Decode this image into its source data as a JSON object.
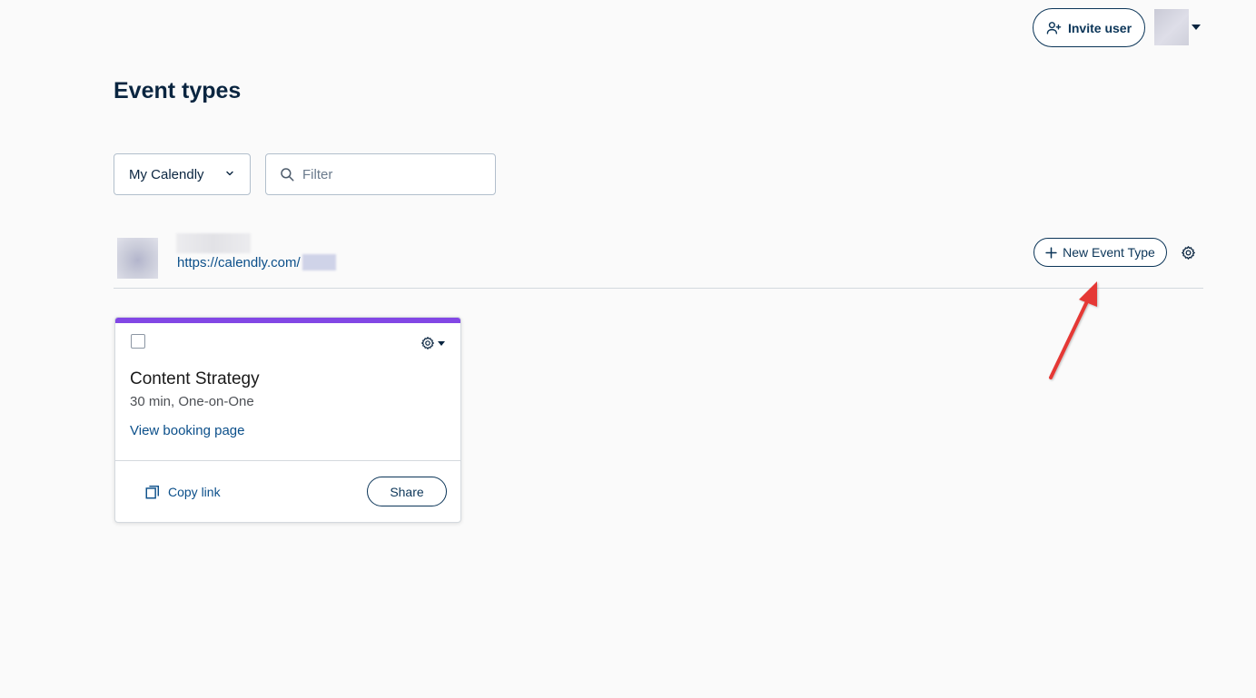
{
  "header": {
    "invite_label": "Invite user"
  },
  "page": {
    "title": "Event types"
  },
  "filters": {
    "calendar_selected": "My Calendly",
    "filter_placeholder": "Filter",
    "filter_value": ""
  },
  "user": {
    "link_text": "https://calendly.com/",
    "new_event_label": "New Event Type"
  },
  "event_cards": [
    {
      "title": "Content Strategy",
      "meta": "30 min, One-on-One",
      "view_link": "View booking page",
      "copy_label": "Copy link",
      "share_label": "Share",
      "accent_color": "#8247e5"
    }
  ],
  "icons": {
    "invite": "add-user-icon",
    "avatar_menu": "caret-down-icon",
    "calendar_select": "chevron-down-icon",
    "filter": "search-icon",
    "new_event": "plus-icon",
    "settings": "gear-icon",
    "copy": "copy-icon"
  },
  "colors": {
    "primary": "#0b3558",
    "link": "#0b4f8a",
    "background": "#fafafa",
    "annotation_arrow": "#e53935"
  }
}
